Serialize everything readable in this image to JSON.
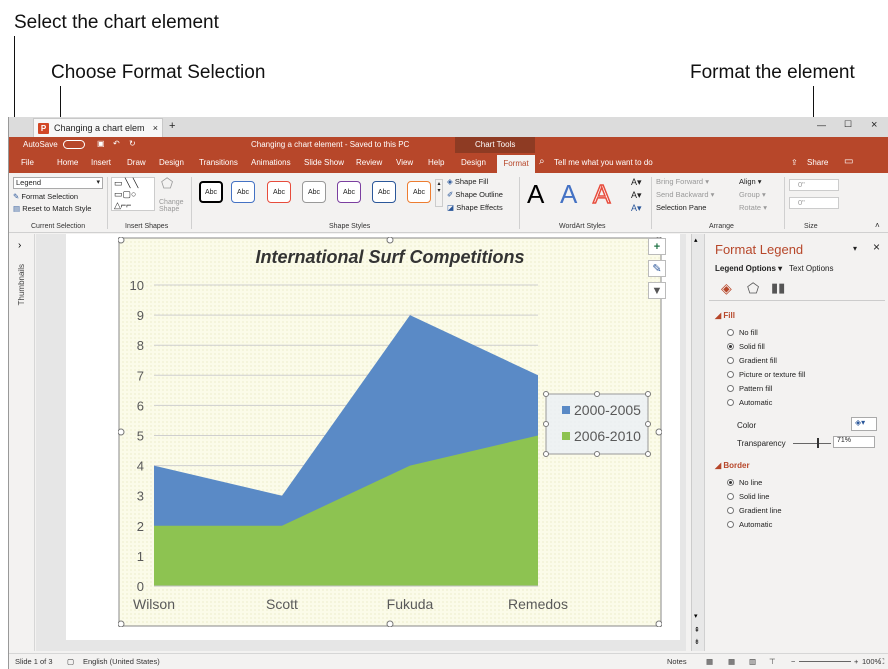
{
  "callouts": {
    "select": "Select the chart element",
    "choose": "Choose Format Selection",
    "format": "Format the element"
  },
  "window": {
    "tab_title": "Changing a chart elem",
    "doc_title": "Changing a chart element - Saved to this PC",
    "chart_tools": "Chart Tools",
    "autosave": "AutoSave"
  },
  "menu": [
    "File",
    "Home",
    "Insert",
    "Draw",
    "Design",
    "Transitions",
    "Animations",
    "Slide Show",
    "Review",
    "View",
    "Help",
    "Design",
    "Format"
  ],
  "tell_me": "Tell me what you want to do",
  "share": "Share",
  "ribbon": {
    "element_select": "Legend",
    "format_selection": "Format Selection",
    "reset": "Reset to Match Style",
    "current_selection": "Current Selection",
    "insert_shapes": "Insert Shapes",
    "change_shape": "Change Shape",
    "shape_styles": "Shape Styles",
    "abc": "Abc",
    "shape_fill": "Shape Fill",
    "shape_outline": "Shape Outline",
    "shape_effects": "Shape Effects",
    "wordart_styles": "WordArt Styles",
    "bring_forward": "Bring Forward",
    "send_backward": "Send Backward",
    "selection_pane": "Selection Pane",
    "align": "Align",
    "group": "Group",
    "rotate": "Rotate",
    "arrange": "Arrange",
    "size": "Size",
    "height_val": "0\"",
    "width_val": "0\""
  },
  "thumbnails": "Thumbnails",
  "pane": {
    "title": "Format Legend",
    "legend_options": "Legend Options",
    "text_options": "Text Options",
    "fill": "Fill",
    "fill_opts": [
      "No fill",
      "Solid fill",
      "Gradient fill",
      "Picture or texture fill",
      "Pattern fill",
      "Automatic"
    ],
    "color": "Color",
    "transparency": "Transparency",
    "transparency_val": "71%",
    "border": "Border",
    "border_opts": [
      "No line",
      "Solid line",
      "Gradient line",
      "Automatic"
    ]
  },
  "status": {
    "slide": "Slide 1 of 3",
    "lang": "English (United States)",
    "notes": "Notes",
    "zoom": "100%"
  },
  "chart_data": {
    "type": "area",
    "title": "International Surf Competitions",
    "categories": [
      "Wilson",
      "Scott",
      "Fukuda",
      "Remedos"
    ],
    "series": [
      {
        "name": "2000-2005",
        "values": [
          4,
          3,
          9,
          7
        ],
        "color": "#5a8ac6"
      },
      {
        "name": "2006-2010",
        "values": [
          2,
          2,
          4,
          5
        ],
        "color": "#8dc351"
      }
    ],
    "ylim": [
      0,
      10
    ],
    "yticks": [
      "0",
      "1",
      "2",
      "3",
      "4",
      "5",
      "6",
      "7",
      "8",
      "9",
      "10"
    ],
    "legend_position": "right"
  }
}
